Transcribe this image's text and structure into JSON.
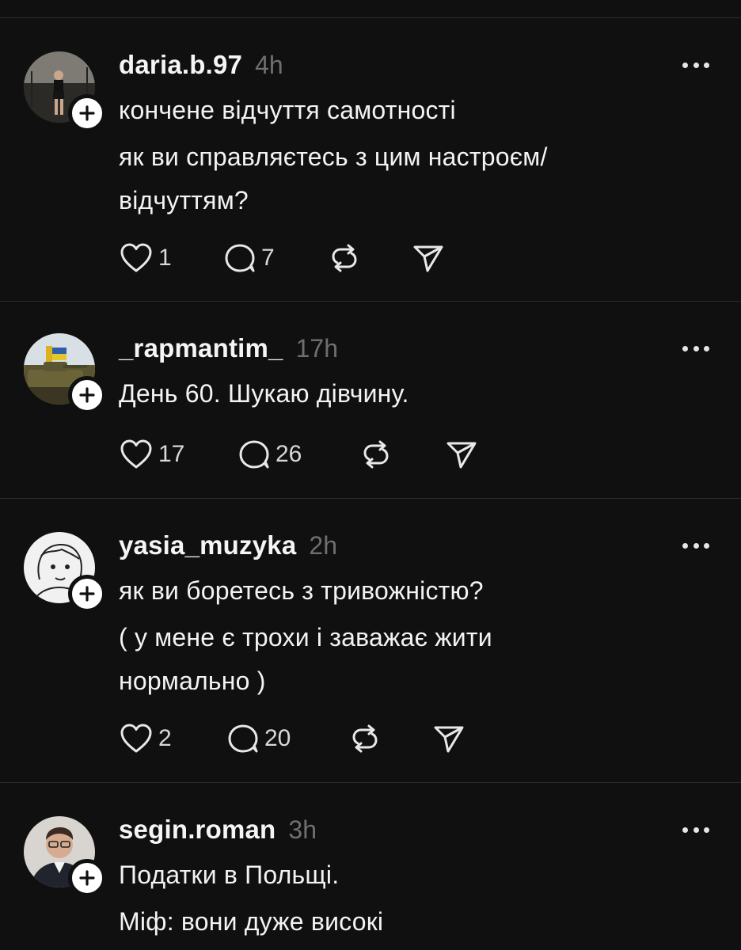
{
  "posts": [
    {
      "username": "daria.b.97",
      "time": "4h",
      "lines": [
        "кончене відчуття самотності",
        "як ви справляєтесь з цим настроєм/",
        "відчуттям?"
      ],
      "likes": "1",
      "replies": "7"
    },
    {
      "username": "_rapmantim_",
      "time": "17h",
      "lines": [
        "День 60. Шукаю дівчину."
      ],
      "likes": "17",
      "replies": "26"
    },
    {
      "username": "yasia_muzyka",
      "time": "2h",
      "lines": [
        "як ви боретесь з тривожністю?",
        "( у мене є трохи і заважає жити",
        "нормально )"
      ],
      "likes": "2",
      "replies": "20"
    },
    {
      "username": "segin.roman",
      "time": "3h",
      "lines": [
        "Податки в Польщі.",
        "Міф: вони дуже високі"
      ]
    }
  ],
  "icons": {
    "like": "heart-icon",
    "reply": "comment-icon",
    "repost": "repost-icon",
    "share": "send-icon",
    "more": "more-dots-icon",
    "follow": "plus-icon"
  },
  "colors": {
    "background": "#101010",
    "divider": "#2c2c2c",
    "text": "#f3f3f3",
    "muted": "#6f6f6f"
  }
}
